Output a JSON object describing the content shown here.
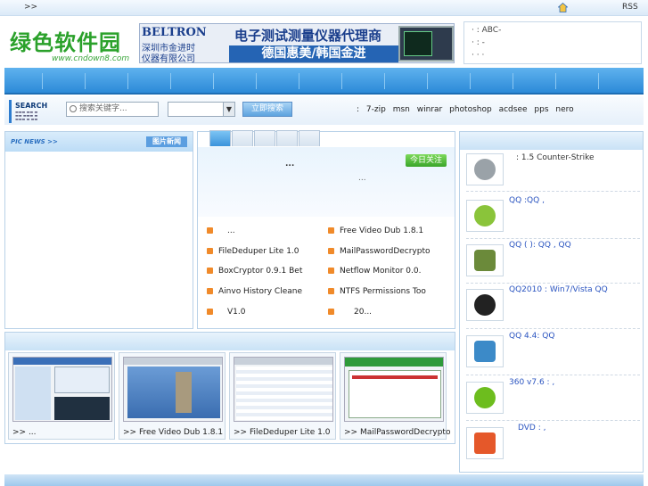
{
  "topbar": {
    "arrows": ">>",
    "rss": "RSS"
  },
  "logo": {
    "name": "绿色软件园",
    "url": "www.cndown8.com"
  },
  "ad": {
    "brand": "BELTRON",
    "company_line1": "深圳市金进时",
    "company_line2": "仪器有限公司",
    "headline": "电子测试测量仪器代理商",
    "subline": "德国惠美/韩国金进"
  },
  "notice": {
    "line1": "·  : ABC-",
    "line2": "·  :  -",
    "line3": "·    ·    ·"
  },
  "search": {
    "title": "SEARCH",
    "placeholder": "搜索关键字...",
    "button": "立即搜索",
    "hot_prefix": ":",
    "hot_keywords": [
      "7-zip",
      "msn",
      "winrar",
      "photoshop",
      "acdsee",
      "pps",
      "nero"
    ]
  },
  "picnews": {
    "title": "PIC NEWS >>",
    "more": "图片新闻"
  },
  "featured": {
    "dots": "...",
    "small": "...",
    "today": "今日关注"
  },
  "list": [
    {
      "text": "..."
    },
    {
      "text": "Free Video Dub 1.8.1"
    },
    {
      "text": "FileDeduper Lite 1.0"
    },
    {
      "text": "MailPasswordDecrypto"
    },
    {
      "text": "BoxCryptor 0.9.1 Bet"
    },
    {
      "text": "Netflow Monitor 0.0."
    },
    {
      "text": "Ainvo History Cleane"
    },
    {
      "text": "NTFS Permissions Too"
    },
    {
      "text": "V1.0"
    },
    {
      "text": "20..."
    }
  ],
  "right_items": [
    {
      "text": ":        1.5 Counter-Strike",
      "color": "#9aa2a8"
    },
    {
      "text": "QQ     :QQ      ,",
      "color": "#8ac43a"
    },
    {
      "text": "QQ (  ):   QQ      ,         QQ",
      "color": "#6b8a3a"
    },
    {
      "text": "QQ2010   : Win7/Vista     QQ",
      "color": "#222222"
    },
    {
      "text": "QQ    4.4:                  QQ",
      "color": "#3c8ac8"
    },
    {
      "text": "360     v7.6  :       ,",
      "color": "#6dbd1e"
    },
    {
      "text": "DVD    :                ,",
      "color": "#e5582a"
    }
  ],
  "gallery": [
    {
      "caption": ">>        ..."
    },
    {
      "caption": ">>  Free Video Dub 1.8.1"
    },
    {
      "caption": ">>  FileDeduper Lite 1.0"
    },
    {
      "caption": ">>  MailPasswordDecrypto"
    }
  ]
}
